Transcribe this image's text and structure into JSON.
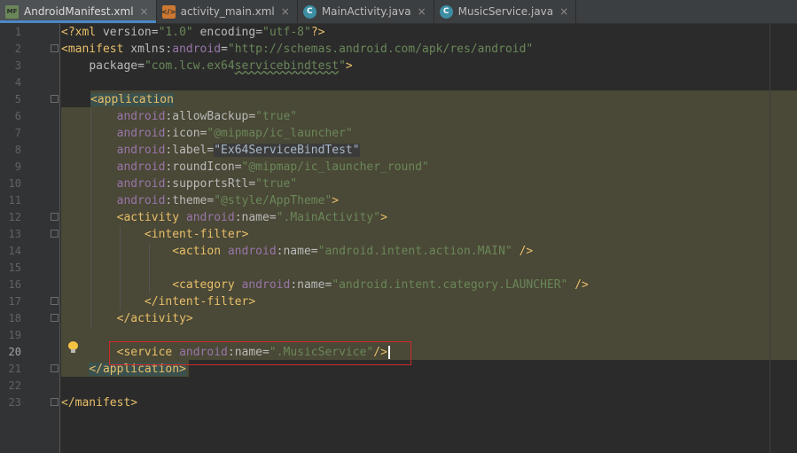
{
  "tabs": [
    {
      "label": "AndroidManifest.xml",
      "icon": "manifest-file-icon",
      "active": true
    },
    {
      "label": "activity_main.xml",
      "icon": "layout-file-icon",
      "active": false
    },
    {
      "label": "MainActivity.java",
      "icon": "java-class-icon",
      "active": false
    },
    {
      "label": "MusicService.java",
      "icon": "java-class-icon",
      "active": false
    }
  ],
  "line_numbers": [
    "1",
    "2",
    "3",
    "4",
    "5",
    "6",
    "7",
    "8",
    "9",
    "10",
    "11",
    "12",
    "13",
    "14",
    "15",
    "16",
    "17",
    "18",
    "19",
    "20",
    "21",
    "22",
    "23"
  ],
  "current_line": "20",
  "code": {
    "l1": {
      "open": "<?xml",
      "attr1": " version",
      "eq1": "=",
      "val1": "\"1.0\"",
      "attr2": " encoding",
      "eq2": "=",
      "val2": "\"utf-8\"",
      "close": "?>"
    },
    "l2": {
      "open": "<manifest",
      "attr": " xmlns",
      "colon": ":",
      "ns": "android",
      "eq": "=",
      "val": "\"http://schemas.android.com/apk/res/android\""
    },
    "l3": {
      "attr": "package",
      "eq": "=",
      "val_pre": "\"com.lcw.ex64",
      "val_squiggle": "servicebindtest",
      "val_post": "\"",
      "close": ">"
    },
    "l5": {
      "open": "<application"
    },
    "l6": {
      "ns": "android",
      "colon": ":",
      "attr": "allowBackup",
      "eq": "=",
      "val": "\"true\""
    },
    "l7": {
      "ns": "android",
      "colon": ":",
      "attr": "icon",
      "eq": "=",
      "val": "\"@mipmap/ic_launcher\""
    },
    "l8": {
      "ns": "android",
      "colon": ":",
      "attr": "label",
      "eq": "=",
      "val": "\"Ex64ServiceBindTest\""
    },
    "l9": {
      "ns": "android",
      "colon": ":",
      "attr": "roundIcon",
      "eq": "=",
      "val": "\"@mipmap/ic_launcher_round\""
    },
    "l10": {
      "ns": "android",
      "colon": ":",
      "attr": "supportsRtl",
      "eq": "=",
      "val": "\"true\""
    },
    "l11": {
      "ns": "android",
      "colon": ":",
      "attr": "theme",
      "eq": "=",
      "val": "\"@style/AppTheme\"",
      "close": ">"
    },
    "l12": {
      "open": "<activity",
      "ns": " android",
      "colon": ":",
      "attr": "name",
      "eq": "=",
      "val": "\".MainActivity\"",
      "close": ">"
    },
    "l13": {
      "open": "<intent-filter",
      "close": ">"
    },
    "l14": {
      "open": "<action",
      "ns": " android",
      "colon": ":",
      "attr": "name",
      "eq": "=",
      "val": "\"android.intent.action.MAIN\"",
      "close": " />"
    },
    "l16": {
      "open": "<category",
      "ns": " android",
      "colon": ":",
      "attr": "name",
      "eq": "=",
      "val": "\"android.intent.category.LAUNCHER\"",
      "close": " />"
    },
    "l17": {
      "text": "</intent-filter>"
    },
    "l18": {
      "text": "</activity>"
    },
    "l20": {
      "open": "<service",
      "ns": " android",
      "colon": ":",
      "attr": "name",
      "eq": "=",
      "val": "\".MusicService\"",
      "close": "/>"
    },
    "l21": {
      "text": "</application>"
    },
    "l23": {
      "text": "</manifest>"
    }
  },
  "colors": {
    "background": "#2b2b2b",
    "gutter": "#313335",
    "tag": "#e8bf6a",
    "attribute": "#bababa",
    "namespace": "#9876aa",
    "value": "#6a8759",
    "block_highlight": "#4a4836",
    "selection_box": "#d12a2a"
  }
}
